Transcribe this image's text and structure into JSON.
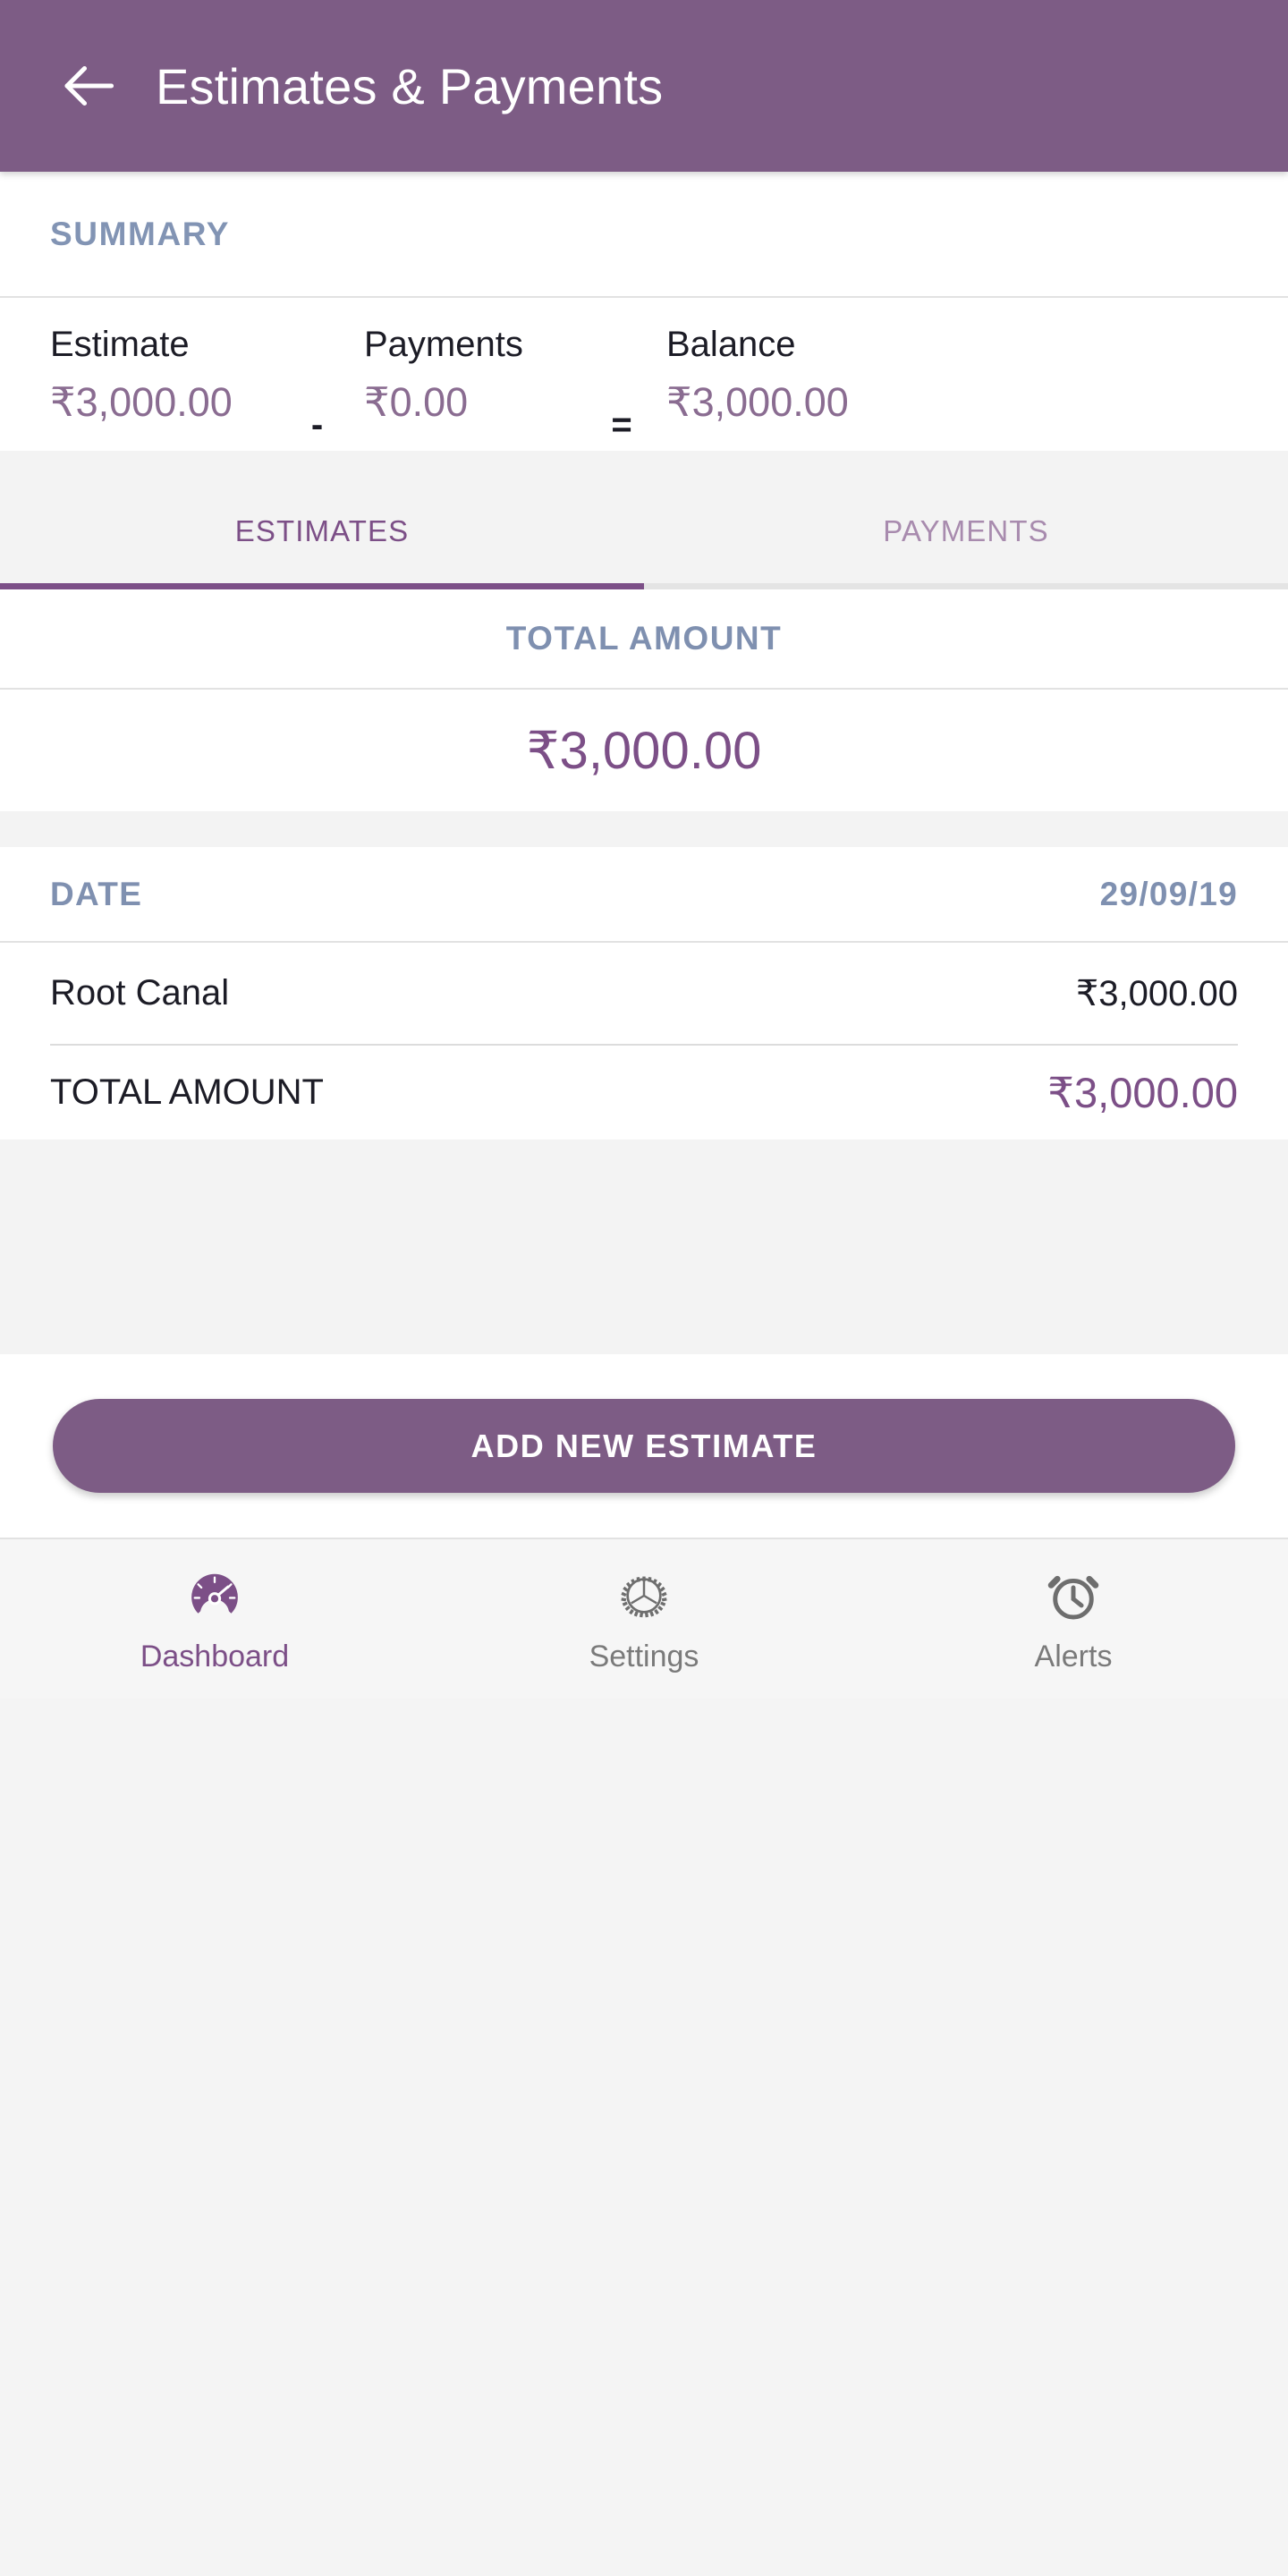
{
  "appbar": {
    "back_icon": "arrow-left-icon",
    "title": "Estimates & Payments"
  },
  "summary": {
    "header": "SUMMARY",
    "estimate_label": "Estimate",
    "estimate_value": "₹3,000.00",
    "operator_minus": "-",
    "payments_label": "Payments",
    "payments_value": "₹0.00",
    "operator_equals": "=",
    "balance_label": "Balance",
    "balance_value": "₹3,000.00"
  },
  "tabs": {
    "items": [
      {
        "label": "ESTIMATES",
        "active": true
      },
      {
        "label": "PAYMENTS",
        "active": false
      }
    ],
    "active_color": "#7c4f87",
    "inactive_color": "#a88bae"
  },
  "total_block": {
    "header": "TOTAL AMOUNT",
    "amount": "₹3,000.00"
  },
  "estimate_card": {
    "date_label": "DATE",
    "date_value": "29/09/19",
    "line_items": [
      {
        "name": "Root Canal",
        "amount": "₹3,000.00"
      }
    ],
    "total_label": "TOTAL AMOUNT",
    "total_amount": "₹3,000.00"
  },
  "cta": {
    "label": "ADD NEW ESTIMATE"
  },
  "bottom_nav": {
    "items": [
      {
        "label": "Dashboard",
        "icon": "speedometer-icon",
        "active": true
      },
      {
        "label": "Settings",
        "icon": "gear-icon",
        "active": false
      },
      {
        "label": "Alerts",
        "icon": "alarm-clock-icon",
        "active": false
      }
    ]
  },
  "colors": {
    "brand_purple": "#7d5c85",
    "accent_purple": "#7c4f87",
    "amount_purple": "#8a6c91",
    "slate_blue": "#7f90b0",
    "text_dark": "#1c1c26"
  }
}
